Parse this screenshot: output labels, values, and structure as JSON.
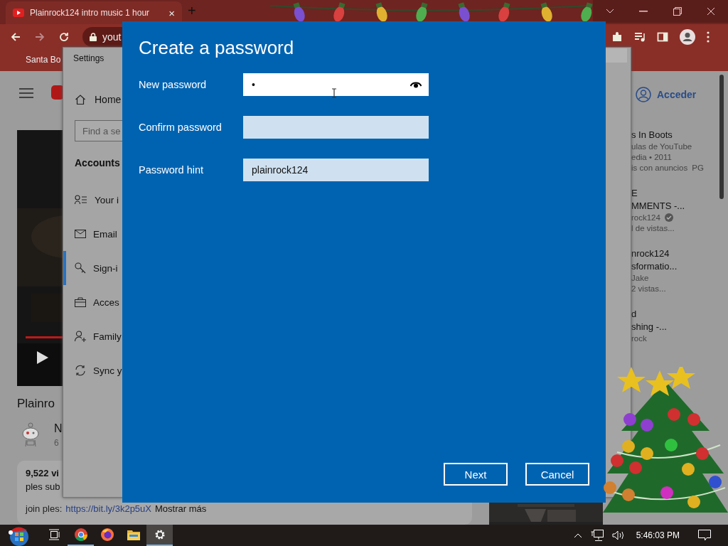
{
  "browser": {
    "tab": {
      "title": "Plainrock124 intro music 1 hour",
      "close": "×"
    },
    "new_tab": "+",
    "address": "yout",
    "bookmark": "Santa Bo"
  },
  "youtube": {
    "signin": "Acceder",
    "video_title": "Plainro",
    "channel_initial": "N",
    "channel_sub": "6",
    "description": [
      "9,522 vi",
      "ples sub"
    ],
    "link_line": {
      "prefix": "join ples:",
      "link": "https://bit.ly/3k2p5uX",
      "more": "Mostrar más"
    },
    "related": [
      {
        "title": [
          "s In Boots"
        ],
        "meta": [
          "ulas de YouTube",
          "edia • 2011"
        ],
        "tags": [
          "is con anuncios",
          "PG"
        ]
      },
      {
        "title": [
          "E",
          "MMENTS -..."
        ],
        "meta": [
          "rock124",
          "l de vistas..."
        ],
        "verified": true
      },
      {
        "title": [
          "nrock124",
          "sformatio..."
        ],
        "meta": [
          "Jake",
          "2 vistas..."
        ]
      },
      {
        "title": [
          "d",
          "shing -..."
        ],
        "meta": [
          "rock"
        ]
      }
    ]
  },
  "settings": {
    "title": "Settings",
    "home": "Home",
    "search_placeholder": "Find a se",
    "section": "Accounts",
    "nav": [
      {
        "kind": "person-list",
        "label": "Your i",
        "selected": false
      },
      {
        "kind": "mail",
        "label": "Email",
        "selected": false
      },
      {
        "kind": "key",
        "label": "Sign-i",
        "selected": true
      },
      {
        "kind": "briefcase",
        "label": "Acces",
        "selected": false
      },
      {
        "kind": "person-add",
        "label": "Family",
        "selected": false
      },
      {
        "kind": "sync",
        "label": "Sync y",
        "selected": false
      }
    ]
  },
  "dialog": {
    "title": "Create a password",
    "fields": [
      {
        "label": "New password",
        "kind": "password",
        "value": "•",
        "focused": true
      },
      {
        "label": "Confirm password",
        "kind": "password",
        "focused": false
      },
      {
        "label": "Password hint",
        "kind": "text",
        "value": "plainrock124",
        "focused": false
      }
    ],
    "buttons": [
      "Next",
      "Cancel"
    ]
  },
  "taskbar": {
    "apps": [
      {
        "kind": "task-view",
        "running": false,
        "selected": false
      },
      {
        "kind": "chrome",
        "running": true,
        "selected": false
      },
      {
        "kind": "firefox",
        "running": false,
        "selected": false
      },
      {
        "kind": "explorer",
        "running": false,
        "selected": false
      },
      {
        "kind": "settings",
        "running": true,
        "selected": true
      }
    ],
    "time": "5:46:03 PM"
  }
}
